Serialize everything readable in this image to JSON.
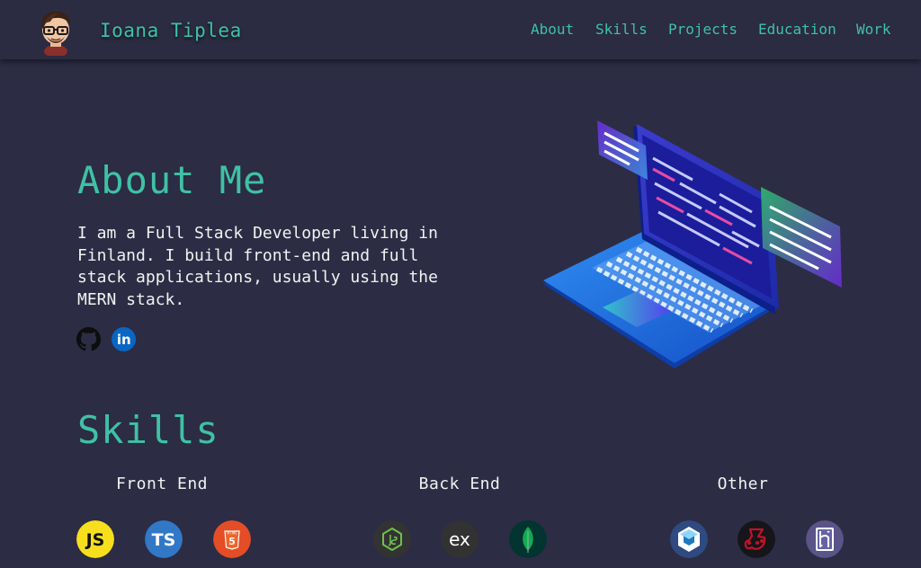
{
  "header": {
    "name": "Ioana Tiplea",
    "nav": [
      "About",
      "Skills",
      "Projects",
      "Education",
      "Work"
    ]
  },
  "about": {
    "title": "About Me",
    "text": "I am a Full Stack Developer living in Finland. I build front-end and full stack applications, usually using the MERN stack.",
    "social_icons": [
      "github-icon",
      "linkedin-icon"
    ]
  },
  "skills": {
    "title": "Skills",
    "categories": [
      {
        "name": "Front End",
        "icons": [
          "javascript-icon",
          "typescript-icon",
          "html5-icon"
        ]
      },
      {
        "name": "Back End",
        "icons": [
          "nodejs-icon",
          "express-icon",
          "mongodb-icon"
        ]
      },
      {
        "name": "Other",
        "icons": [
          "webpack-icon",
          "jest-icon",
          "heroku-icon"
        ]
      }
    ]
  },
  "icon_text": {
    "js": "JS",
    "ts": "TS",
    "html_badge": "HTML",
    "html_num": "5",
    "ex": "ex",
    "li": "in"
  },
  "colors": {
    "background": "#2c2c44",
    "accent": "#3fc1a5",
    "javascript": "#f7df1e",
    "typescript": "#3178c6",
    "html5": "#e44d26",
    "linkedin": "#0a66c2"
  }
}
